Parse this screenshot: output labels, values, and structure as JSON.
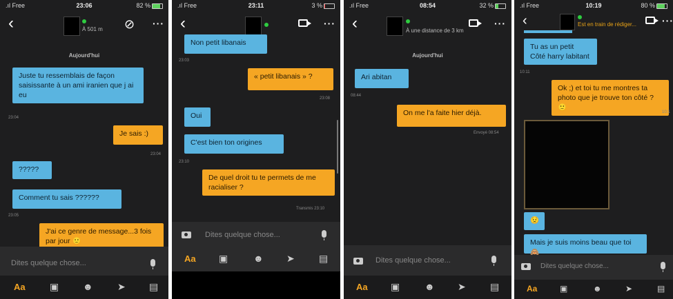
{
  "placeholder": "Dites quelque chose...",
  "screens": [
    {
      "status": {
        "carrier": "Free",
        "time": "23:06",
        "battery": "82 %"
      },
      "subtitle": "À 501 m",
      "day": "Aujourd'hui",
      "messages": [
        {
          "text": "Juste tu ressemblais de façon saisissante à un ami iranien que j ai eu",
          "time": "23:04"
        },
        {
          "text": "Je sais :)",
          "time": "23:04"
        },
        {
          "text": "?????"
        },
        {
          "text": "Comment tu sais ??????",
          "time": "23:05"
        },
        {
          "text": "J'ai ce genre de message...3 fois par jour 🙂"
        }
      ]
    },
    {
      "status": {
        "carrier": "Free",
        "time": "23:11",
        "battery": "3 %"
      },
      "messages": [
        {
          "text": "Non petit libanais",
          "time": "23:03"
        },
        {
          "text": "« petit libanais » ?",
          "time": "23:08"
        },
        {
          "text": "Oui"
        },
        {
          "text": "C'est bien ton origines",
          "time": "23:10"
        },
        {
          "text": "De quel droit tu te permets de me racialiser ?",
          "time": "Transmis 23:10"
        }
      ]
    },
    {
      "status": {
        "carrier": "Free",
        "time": "08:54",
        "battery": "32 %"
      },
      "subtitle": "À une distance de 3 km",
      "day": "Aujourd'hui",
      "messages": [
        {
          "text": "Ari abitan",
          "time": "08:44"
        },
        {
          "text": "On me l'a faite hier déjà.",
          "time": "Envoyé 08:54"
        }
      ]
    },
    {
      "status": {
        "carrier": "Free",
        "time": "10:19",
        "battery": "80 %"
      },
      "subtitle": "Est en train de rédiger...",
      "messages": [
        {
          "text": "Tu as un petit\nCôté harry labitant",
          "time": "10:11"
        },
        {
          "text": "Ok ;) et toi tu me montres ta photo que je trouve ton côté ? 🙂",
          "time": "10:1"
        },
        {
          "text": "😟"
        },
        {
          "text": "Mais je suis moins beau que toi 🙈"
        }
      ]
    }
  ],
  "icons": {
    "back": "‹",
    "block": "⊘",
    "more": "···",
    "aa": "Aa",
    "photo": "camera-icon",
    "emoji": "emoji-icon",
    "send": "location-icon",
    "gif": "sticker-icon"
  }
}
